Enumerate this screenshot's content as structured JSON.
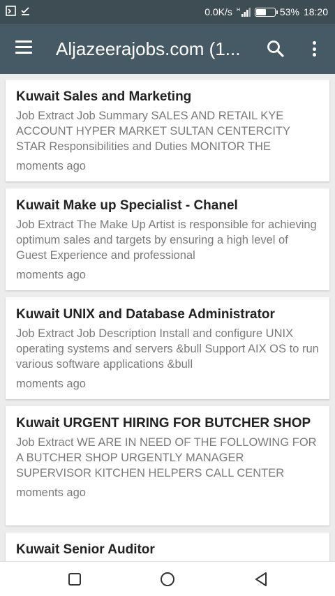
{
  "status_bar": {
    "network_speed": "0.0K/s",
    "battery_percent": "53%",
    "battery_level": 0.53,
    "time": "18:20"
  },
  "app_bar": {
    "title": "Aljazeerajobs.com (1..."
  },
  "jobs": [
    {
      "title": "Kuwait Sales and Marketing",
      "description": "Job Extract Job Summary SALES AND RETAIL KYE ACCOUNT HYPER MARKET SULTAN CENTERCITY STAR Responsibilities and Duties MONITOR THE",
      "time": "moments ago"
    },
    {
      "title": "Kuwait Make up Specialist - Chanel",
      "description": "Job Extract The Make Up Artist is responsible for achieving optimum sales and targets by ensuring a high level of Guest Experience and professional",
      "time": "moments ago"
    },
    {
      "title": "Kuwait UNIX and Database Administrator",
      "description": "Job Extract Job Description Install and configure UNIX operating systems and servers &bull Support AIX OS to run various software applications &bull",
      "time": "moments ago"
    },
    {
      "title": "Kuwait URGENT HIRING FOR BUTCHER SHOP",
      "description": "Job Extract WE ARE IN NEED OF THE FOLLOWING FOR A BUTCHER SHOP URGENTLY MANAGER SUPERVISOR KITCHEN HELPERS CALL CENTER",
      "time": "moments ago"
    },
    {
      "title": "Kuwait Senior Auditor",
      "description": "",
      "time": ""
    }
  ],
  "icons": {
    "menu": "hamburger-menu-icon",
    "search": "search-icon",
    "more": "more-vert-icon",
    "recents": "square-icon",
    "home": "circle-icon",
    "back": "triangle-back-icon"
  },
  "colors": {
    "app_bar": "#455a64",
    "status_bar": "#3e4c54",
    "background": "#ececec"
  }
}
